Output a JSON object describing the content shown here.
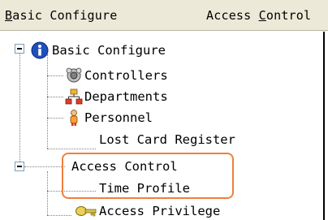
{
  "menubar": {
    "items": [
      {
        "prefix": "",
        "accel": "B",
        "rest": "asic Configure"
      },
      {
        "prefix": "Access ",
        "accel": "C",
        "rest": "ontrol"
      }
    ]
  },
  "tree": {
    "nodes": [
      {
        "label": "Basic Configure",
        "icon": "info-icon",
        "level": 0,
        "expanded": true
      },
      {
        "label": "Controllers",
        "icon": "controllers-icon",
        "level": 1
      },
      {
        "label": "Departments",
        "icon": "departments-icon",
        "level": 1
      },
      {
        "label": "Personnel",
        "icon": "personnel-icon",
        "level": 1
      },
      {
        "label": "Lost Card Register",
        "icon": "",
        "level": 1
      },
      {
        "label": "Access Control",
        "icon": "",
        "level": 0,
        "expanded": true
      },
      {
        "label": "Time Profile",
        "icon": "",
        "level": 1
      },
      {
        "label": "Access Privilege",
        "icon": "key-icon",
        "level": 1
      }
    ]
  },
  "colors": {
    "menubar_bg": "#ece9d8",
    "highlight_border": "#f07f3c",
    "info_icon": "#1f4fb8"
  }
}
